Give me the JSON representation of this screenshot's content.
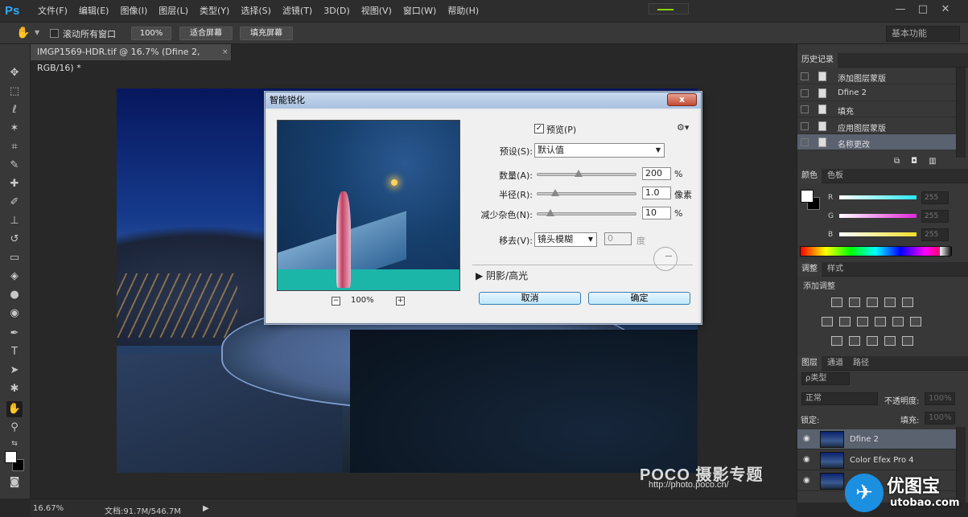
{
  "app": {
    "logo": "Ps"
  },
  "menu": [
    "文件(F)",
    "编辑(E)",
    "图像(I)",
    "图层(L)",
    "类型(Y)",
    "选择(S)",
    "滤镜(T)",
    "3D(D)",
    "视图(V)",
    "窗口(W)",
    "帮助(H)"
  ],
  "window_controls": {
    "minimize": "—",
    "restore": "□",
    "close": "✕"
  },
  "options_bar": {
    "scroll_all_windows": "滚动所有窗口",
    "btn_100": "100%",
    "btn_fit_screen": "适合屏幕",
    "btn_fill_screen": "填充屏幕",
    "workspace": "基本功能"
  },
  "document": {
    "tab_title": "IMGP1569-HDR.tif @ 16.7% (Dfine 2, RGB/16) *",
    "tab_close": "×"
  },
  "watermark": {
    "brand": "POCO 摄影专题",
    "url": "http://photo.poco.cn/"
  },
  "dialog": {
    "title": "智能锐化",
    "close": "x",
    "preview_label": "预览(P)",
    "preview_checked": "✓",
    "zoom": "100%",
    "zoom_minus": "−",
    "zoom_plus": "+",
    "preset_label": "预设(S):",
    "preset_value": "默认值",
    "amount_label": "数量(A):",
    "amount_value": "200",
    "amount_unit": "%",
    "amount_level": 0.4,
    "radius_label": "半径(R):",
    "radius_value": "1.0",
    "radius_unit": "像素",
    "radius_level": 0.15,
    "noise_label": "减少杂色(N):",
    "noise_value": "10",
    "noise_unit": "%",
    "noise_level": 0.1,
    "remove_label": "移去(V):",
    "remove_value": "镜头模糊",
    "angle_value": "0",
    "angle_unit": "度",
    "shadows_label": "阴影/高光",
    "cancel": "取消",
    "ok": "确定"
  },
  "history": {
    "tab": "历史记录",
    "items": [
      "添加图层蒙版",
      "Dfine 2",
      "填充",
      "应用图层蒙版",
      "名称更改"
    ],
    "selected_index": 4
  },
  "color_panel": {
    "tabs": [
      "颜色",
      "色板"
    ],
    "channels": [
      {
        "label": "R",
        "value": "255",
        "color": "#28e8f0"
      },
      {
        "label": "G",
        "value": "255",
        "color": "#e028d8"
      },
      {
        "label": "B",
        "value": "255",
        "color": "#f0e028"
      }
    ]
  },
  "adjustments": {
    "tabs": [
      "调整",
      "样式"
    ],
    "title": "添加调整"
  },
  "layers": {
    "tabs": [
      "图层",
      "通道",
      "路径"
    ],
    "filter": "ρ类型",
    "blend_mode": "正常",
    "opacity_label": "不透明度:",
    "opacity_value": "100%",
    "lock_label": "锁定:",
    "fill_label": "填充:",
    "fill_value": "100%",
    "items": [
      "Dfine 2",
      "Color Efex Pro 4",
      "图层 1"
    ],
    "selected_index": 0
  },
  "status": {
    "zoom": "16.67%",
    "doc_info": "文档:91.7M/546.7M"
  },
  "corner_logo": {
    "cn": "优图宝",
    "en": "utobao.com"
  }
}
